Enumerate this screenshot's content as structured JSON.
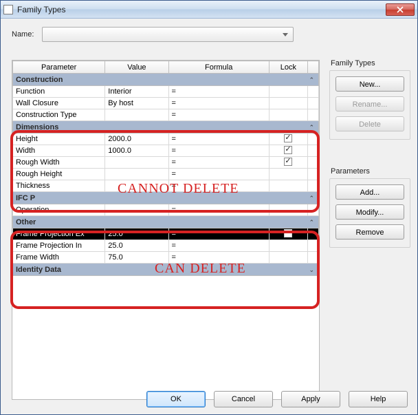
{
  "window": {
    "title": "Family Types"
  },
  "name": {
    "label": "Name:"
  },
  "headers": {
    "parameter": "Parameter",
    "value": "Value",
    "formula": "Formula",
    "lock": "Lock"
  },
  "groups": {
    "construction": {
      "label": "Construction",
      "rows": [
        {
          "param": "Function",
          "value": "Interior",
          "formula": "=",
          "lock": false,
          "showLock": false
        },
        {
          "param": "Wall Closure",
          "value": "By host",
          "formula": "=",
          "lock": false,
          "showLock": false
        },
        {
          "param": "Construction Type",
          "value": "",
          "formula": "=",
          "lock": false,
          "showLock": false
        }
      ]
    },
    "dimensions": {
      "label": "Dimensions",
      "rows": [
        {
          "param": "Height",
          "value": "2000.0",
          "formula": "=",
          "lock": true,
          "showLock": true
        },
        {
          "param": "Width",
          "value": "1000.0",
          "formula": "=",
          "lock": true,
          "showLock": true
        },
        {
          "param": "Rough Width",
          "value": "",
          "formula": "=",
          "lock": true,
          "showLock": true
        },
        {
          "param": "Rough Height",
          "value": "",
          "formula": "=",
          "lock": false,
          "showLock": false
        },
        {
          "param": "Thickness",
          "value": "",
          "formula": "=",
          "lock": false,
          "showLock": false
        }
      ]
    },
    "ifc": {
      "label": "IFC Parameters",
      "rows": [
        {
          "param": "Operation",
          "value": "",
          "formula": "=",
          "lock": false,
          "showLock": false
        }
      ]
    },
    "other": {
      "label": "Other",
      "rows": [
        {
          "param": "Frame Projection Ex",
          "value": "25.0",
          "formula": "=",
          "lock": true,
          "showLock": true,
          "selected": true
        },
        {
          "param": "Frame Projection In",
          "value": "25.0",
          "formula": "=",
          "lock": false,
          "showLock": false
        },
        {
          "param": "Frame Width",
          "value": "75.0",
          "formula": "=",
          "lock": false,
          "showLock": false
        }
      ]
    },
    "identity": {
      "label": "Identity Data"
    }
  },
  "side": {
    "familyTypes": {
      "label": "Family Types",
      "new": "New...",
      "rename": "Rename...",
      "delete": "Delete"
    },
    "parameters": {
      "label": "Parameters",
      "add": "Add...",
      "modify": "Modify...",
      "remove": "Remove"
    }
  },
  "footer": {
    "ok": "OK",
    "cancel": "Cancel",
    "apply": "Apply",
    "help": "Help"
  },
  "annotations": {
    "cannot": "CANNOT DELETE",
    "can": "CAN DELETE"
  }
}
